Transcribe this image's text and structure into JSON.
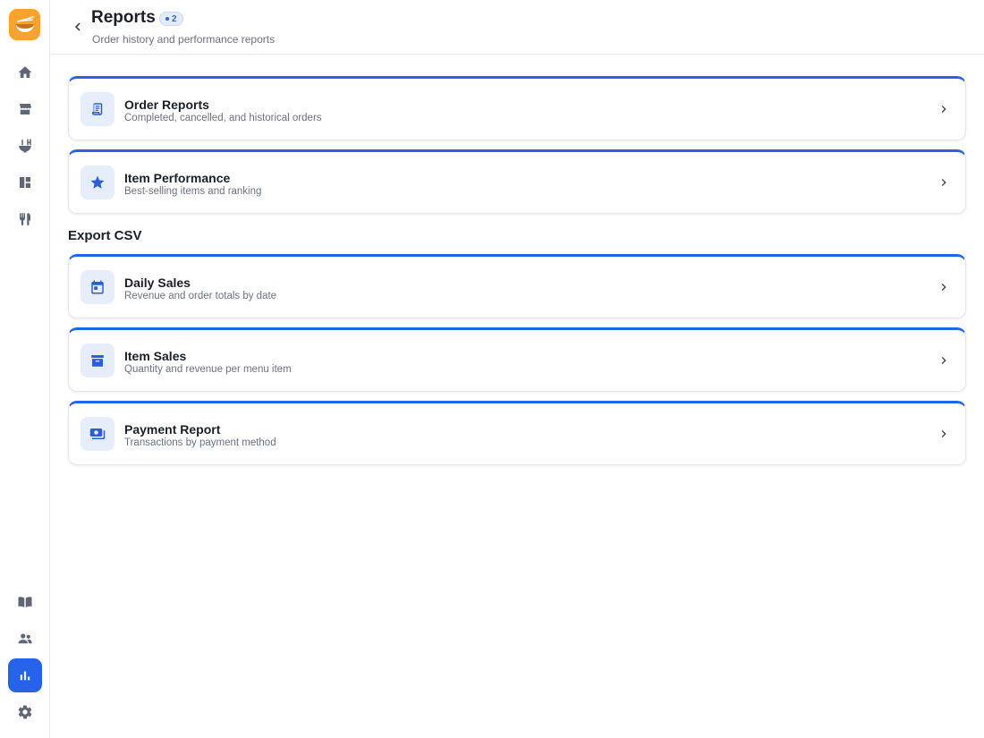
{
  "header": {
    "title": "Reports",
    "badge_count": "2",
    "subtitle": "Order history and performance reports"
  },
  "sidebar": {
    "top_items": [
      {
        "name": "home",
        "icon": "home-icon"
      },
      {
        "name": "store",
        "icon": "storefront-icon"
      },
      {
        "name": "kitchen",
        "icon": "noodle-bowl-icon"
      },
      {
        "name": "dashboard",
        "icon": "dashboard-icon"
      },
      {
        "name": "dining",
        "icon": "utensils-icon"
      }
    ],
    "bottom_items": [
      {
        "name": "menu",
        "icon": "menu-book-icon"
      },
      {
        "name": "users",
        "icon": "people-icon"
      },
      {
        "name": "reports",
        "icon": "bar-chart-icon",
        "active": true
      },
      {
        "name": "settings",
        "icon": "gear-icon"
      }
    ],
    "active_color": "#2563eb",
    "logo_color": "#f5a431"
  },
  "reports": [
    {
      "title": "Order Reports",
      "desc": "Completed, cancelled, and historical orders",
      "icon": "receipt-icon"
    },
    {
      "title": "Item Performance",
      "desc": "Best-selling items and ranking",
      "icon": "star-icon"
    }
  ],
  "export_section": {
    "title": "Export CSV",
    "items": [
      {
        "title": "Daily Sales",
        "desc": "Revenue and order totals by date",
        "icon": "calendar-icon"
      },
      {
        "title": "Item Sales",
        "desc": "Quantity and revenue per menu item",
        "icon": "archive-box-icon"
      },
      {
        "title": "Payment Report",
        "desc": "Transactions by payment method",
        "icon": "payments-icon"
      }
    ]
  },
  "accent_color": "#2563eb"
}
